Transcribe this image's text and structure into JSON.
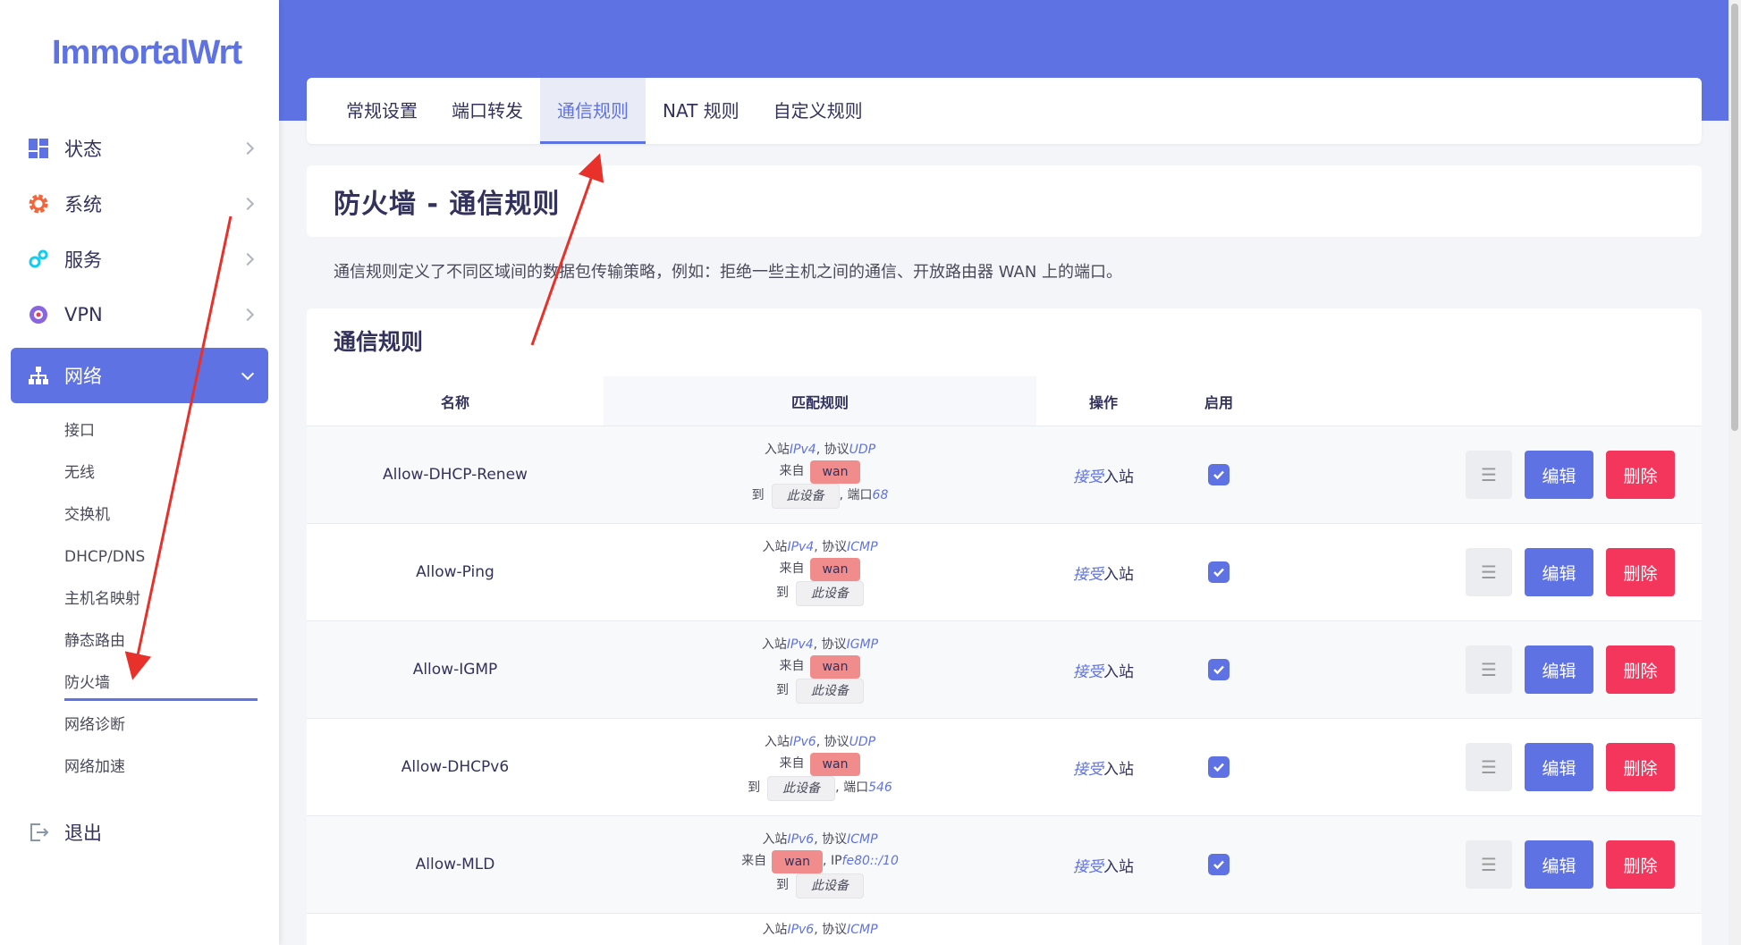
{
  "brand": "ImmortalWrt",
  "sidebar": {
    "items": [
      {
        "label": "状态",
        "icon": "dashboard-icon"
      },
      {
        "label": "系统",
        "icon": "gear-icon"
      },
      {
        "label": "服务",
        "icon": "services-icon"
      },
      {
        "label": "VPN",
        "icon": "vpn-icon"
      },
      {
        "label": "网络",
        "icon": "network-icon"
      }
    ],
    "network_sub": [
      "接口",
      "无线",
      "交换机",
      "DHCP/DNS",
      "主机名映射",
      "静态路由",
      "防火墙",
      "网络诊断",
      "网络加速"
    ],
    "active_sub": "防火墙",
    "logout": "退出"
  },
  "tabs": [
    "常规设置",
    "端口转发",
    "通信规则",
    "NAT 规则",
    "自定义规则"
  ],
  "active_tab": "通信规则",
  "page_title": "防火墙 - 通信规则",
  "description": "通信规则定义了不同区域间的数据包传输策略，例如：拒绝一些主机之间的通信、开放路由器 WAN 上的端口。",
  "section_title": "通信规则",
  "table": {
    "headers": {
      "name": "名称",
      "match": "匹配规则",
      "action": "操作",
      "enable": "启用"
    },
    "rows": [
      {
        "name": "Allow-DHCP-Renew",
        "ipver": "IPv4",
        "proto": "UDP",
        "from": "wan",
        "to": "此设备",
        "port": "68",
        "ip": ""
      },
      {
        "name": "Allow-Ping",
        "ipver": "IPv4",
        "proto": "ICMP",
        "from": "wan",
        "to": "此设备",
        "port": "",
        "ip": ""
      },
      {
        "name": "Allow-IGMP",
        "ipver": "IPv4",
        "proto": "IGMP",
        "from": "wan",
        "to": "此设备",
        "port": "",
        "ip": ""
      },
      {
        "name": "Allow-DHCPv6",
        "ipver": "IPv6",
        "proto": "UDP",
        "from": "wan",
        "to": "此设备",
        "port": "546",
        "ip": ""
      },
      {
        "name": "Allow-MLD",
        "ipver": "IPv6",
        "proto": "ICMP",
        "from": "wan",
        "to": "此设备",
        "port": "",
        "ip": "fe80::/10"
      }
    ],
    "partial_row": {
      "ipver": "IPv6",
      "proto": "ICMP"
    },
    "text": {
      "inbound": "入站",
      "proto": ", 协议",
      "from": "来自",
      "to": "到",
      "port": ", 端口",
      "ip": ", IP",
      "accept": "接受",
      "action_suffix": "入站"
    },
    "buttons": {
      "drag": "☰",
      "edit": "编辑",
      "delete": "删除"
    }
  },
  "colors": {
    "accent": "#5e72e4",
    "danger": "#f5365c",
    "zone_wan": "#f08c8c",
    "annotation": "#e8312a"
  }
}
